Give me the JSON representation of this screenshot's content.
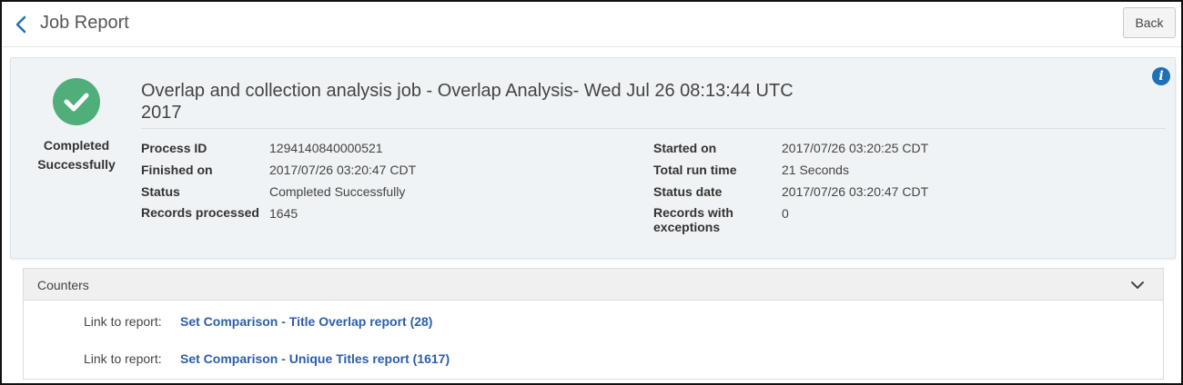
{
  "header": {
    "title": "Job Report",
    "back_label": "Back"
  },
  "summary": {
    "status_text": "Completed Successfully",
    "job_title": "Overlap and collection analysis job - Overlap Analysis- Wed Jul 26 08:13:44 UTC 2017",
    "status_color": "#4fae7a",
    "left_fields": [
      {
        "label": "Process ID",
        "value": "1294140840000521"
      },
      {
        "label": "Finished on",
        "value": "2017/07/26 03:20:47 CDT"
      },
      {
        "label": "Status",
        "value": "Completed Successfully"
      },
      {
        "label": "Records processed",
        "value": "1645"
      }
    ],
    "right_fields": [
      {
        "label": "Started on",
        "value": "2017/07/26 03:20:25 CDT"
      },
      {
        "label": "Total run time",
        "value": "21 Seconds"
      },
      {
        "label": "Status date",
        "value": "2017/07/26 03:20:47 CDT"
      },
      {
        "label": "Records with exceptions",
        "value": "0"
      }
    ]
  },
  "counters": {
    "title": "Counters",
    "links": [
      {
        "label": "Link to report:",
        "text": "Set Comparison - Title Overlap report (28)"
      },
      {
        "label": "Link to report:",
        "text": "Set Comparison - Unique Titles report (1617)"
      }
    ]
  },
  "colors": {
    "accent": "#1d71b8",
    "link": "#2d5ea8"
  }
}
